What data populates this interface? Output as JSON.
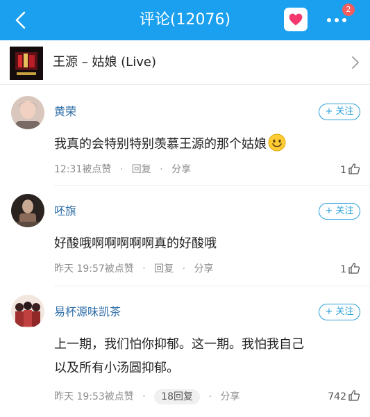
{
  "header": {
    "title": "评论(12076)",
    "notification_count": "2",
    "accent_color": "#1aa0ee"
  },
  "song": {
    "title": "王源 – 姑娘 (Live)"
  },
  "comments": [
    {
      "user": "黄荣",
      "follow_label": "+ 关注",
      "text": "我真的会特别特别羡慕王源的那个姑娘",
      "time": "12:31",
      "liked_label": "被点赞",
      "reply_label": "回复",
      "share_label": "分享",
      "likes": "1"
    },
    {
      "user": "呸旗",
      "follow_label": "+ 关注",
      "text": "好酸哦啊啊啊啊啊真的好酸哦",
      "time": "昨天 19:57",
      "liked_label": "被点赞",
      "reply_label": "回复",
      "share_label": "分享",
      "likes": "1"
    },
    {
      "user": "易杯源味凯茶",
      "follow_label": "+ 关注",
      "text_line1": "上一期，我们怕你抑郁。这一期。我怕我自己",
      "text_line2": "以及所有小汤圆抑郁。",
      "time": "昨天 19:53",
      "liked_label": "被点赞",
      "reply_label": "18回复",
      "share_label": "分享",
      "likes": "742"
    }
  ]
}
